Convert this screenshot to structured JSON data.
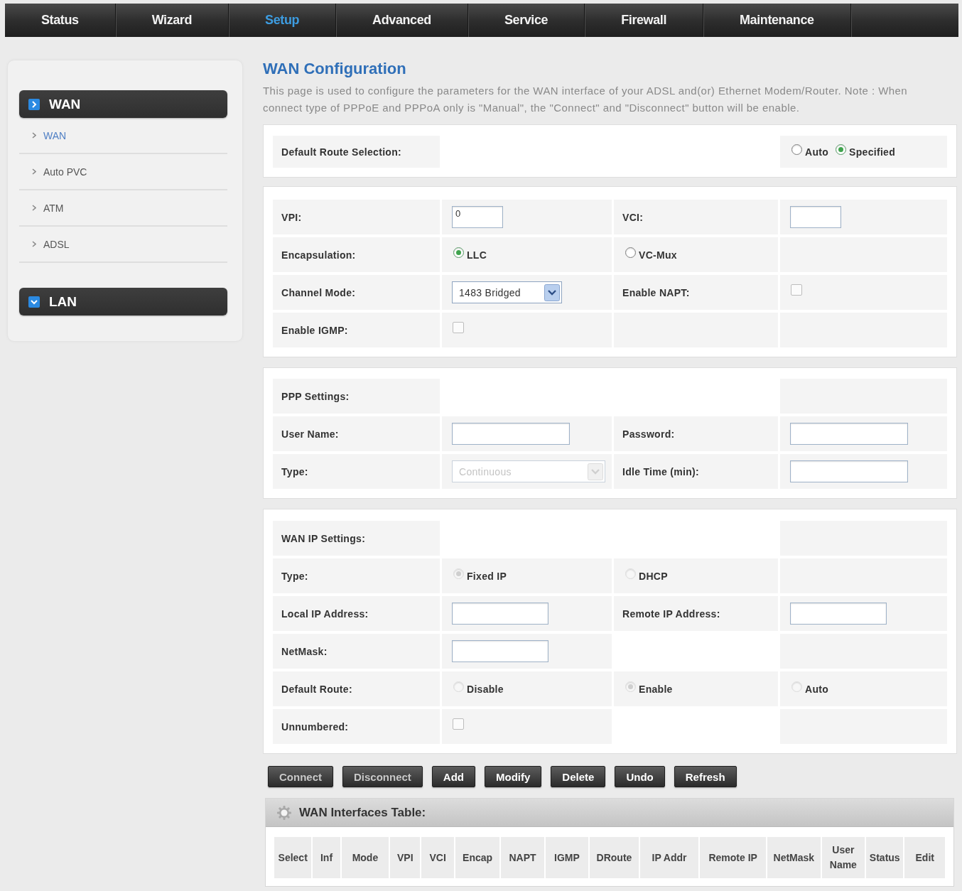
{
  "nav": [
    {
      "label": "Status",
      "selected": false
    },
    {
      "label": "Wizard",
      "selected": false
    },
    {
      "label": "Setup",
      "selected": true
    },
    {
      "label": "Advanced",
      "selected": false
    },
    {
      "label": "Service",
      "selected": false
    },
    {
      "label": "Firewall",
      "selected": false
    },
    {
      "label": "Maintenance",
      "selected": false
    }
  ],
  "sidebar": {
    "groups": [
      {
        "title": "WAN",
        "expanded": true,
        "items": [
          {
            "label": "WAN",
            "selected": true
          },
          {
            "label": "Auto PVC",
            "selected": false
          },
          {
            "label": "ATM",
            "selected": false
          },
          {
            "label": "ADSL",
            "selected": false
          }
        ]
      },
      {
        "title": "LAN",
        "expanded": false
      }
    ]
  },
  "page": {
    "title": "WAN Configuration",
    "description": "This page is used to configure the parameters for the WAN interface of your ADSL and(or) Ethernet Modem/Router. Note : When connect type of PPPoE and PPPoA only is \"Manual\", the \"Connect\" and \"Disconnect\" button will be enable."
  },
  "sections": [
    {
      "rows": [
        {
          "cells": [
            {
              "kind": "label",
              "text": "Default Route Selection:"
            },
            {
              "kind": "radios",
              "disabled": false,
              "options": [
                {
                  "label": "Auto",
                  "selected": false
                },
                {
                  "label": "Specified",
                  "selected": true
                }
              ]
            }
          ]
        }
      ]
    },
    {
      "rows": [
        {
          "cells": [
            {
              "kind": "label",
              "text": "VPI:"
            },
            {
              "kind": "input",
              "value": "0"
            },
            {
              "kind": "label",
              "text": "VCI:"
            },
            {
              "kind": "input"
            }
          ]
        },
        {
          "cells": [
            {
              "kind": "label",
              "text": "Encapsulation:"
            },
            {
              "kind": "radios",
              "disabled": false,
              "options": [
                {
                  "label": "LLC",
                  "selected": true
                }
              ]
            },
            {
              "kind": "radios",
              "disabled": false,
              "options": [
                {
                  "label": "VC-Mux",
                  "selected": false
                }
              ]
            },
            {
              "kind": "empty"
            }
          ]
        },
        {
          "cells": [
            {
              "kind": "label",
              "text": "Channel Mode:"
            },
            {
              "kind": "select",
              "value": "1483 Bridged",
              "disabled": false
            },
            {
              "kind": "label",
              "text": "Enable NAPT:"
            },
            {
              "kind": "checkbox",
              "checked": false
            }
          ]
        },
        {
          "cells": [
            {
              "kind": "label",
              "text": "Enable IGMP:"
            },
            {
              "kind": "checkbox",
              "checked": false
            },
            {
              "kind": "empty"
            },
            {
              "kind": "empty"
            }
          ]
        }
      ]
    },
    {
      "rows": [
        {
          "cells": [
            {
              "kind": "label",
              "text": "PPP Settings:"
            },
            {
              "kind": "empty"
            }
          ]
        },
        {
          "cells": [
            {
              "kind": "label",
              "text": "User Name:"
            },
            {
              "kind": "input"
            },
            {
              "kind": "label",
              "text": "Password:"
            },
            {
              "kind": "input"
            }
          ]
        },
        {
          "cells": [
            {
              "kind": "label",
              "text": "Type:"
            },
            {
              "kind": "select",
              "value": "Continuous",
              "disabled": true
            },
            {
              "kind": "label",
              "text": "Idle Time (min):"
            },
            {
              "kind": "input"
            }
          ]
        }
      ]
    },
    {
      "rows": [
        {
          "cells": [
            {
              "kind": "label",
              "text": "WAN IP Settings:"
            },
            {
              "kind": "empty"
            }
          ]
        },
        {
          "cells": [
            {
              "kind": "label",
              "text": "Type:"
            },
            {
              "kind": "radios",
              "disabled": true,
              "options": [
                {
                  "label": "Fixed IP",
                  "selected": true
                }
              ]
            },
            {
              "kind": "radios",
              "disabled": true,
              "options": [
                {
                  "label": "DHCP",
                  "selected": false
                }
              ]
            },
            {
              "kind": "empty"
            }
          ]
        },
        {
          "cells": [
            {
              "kind": "label",
              "text": "Local IP Address:"
            },
            {
              "kind": "input"
            },
            {
              "kind": "label",
              "text": "Remote IP Address:"
            },
            {
              "kind": "input"
            }
          ]
        },
        {
          "cells": [
            {
              "kind": "label",
              "text": "NetMask:"
            },
            {
              "kind": "input"
            },
            {
              "kind": "empty"
            }
          ]
        },
        {
          "cells": [
            {
              "kind": "label",
              "text": "Default Route:"
            },
            {
              "kind": "radios",
              "disabled": true,
              "options": [
                {
                  "label": "Disable",
                  "selected": false
                }
              ]
            },
            {
              "kind": "radios",
              "disabled": true,
              "options": [
                {
                  "label": "Enable",
                  "selected": true
                }
              ]
            },
            {
              "kind": "radios",
              "disabled": true,
              "options": [
                {
                  "label": "Auto",
                  "selected": false
                }
              ]
            }
          ]
        },
        {
          "cells": [
            {
              "kind": "label",
              "text": "Unnumbered:"
            },
            {
              "kind": "checkbox",
              "checked": false
            },
            {
              "kind": "empty"
            }
          ]
        }
      ]
    }
  ],
  "buttons": [
    {
      "label": "Connect",
      "disabled": true
    },
    {
      "label": "Disconnect",
      "disabled": true
    },
    {
      "label": "Add",
      "disabled": false
    },
    {
      "label": "Modify",
      "disabled": false
    },
    {
      "label": "Delete",
      "disabled": false
    },
    {
      "label": "Undo",
      "disabled": false
    },
    {
      "label": "Refresh",
      "disabled": false
    }
  ],
  "table": {
    "title": "WAN Interfaces Table:",
    "columns": [
      "Select",
      "Inf",
      "Mode",
      "VPI",
      "VCI",
      "Encap",
      "NAPT",
      "IGMP",
      "DRoute",
      "IP Addr",
      "Remote IP",
      "NetMask",
      "User Name",
      "Status",
      "Edit"
    ]
  }
}
